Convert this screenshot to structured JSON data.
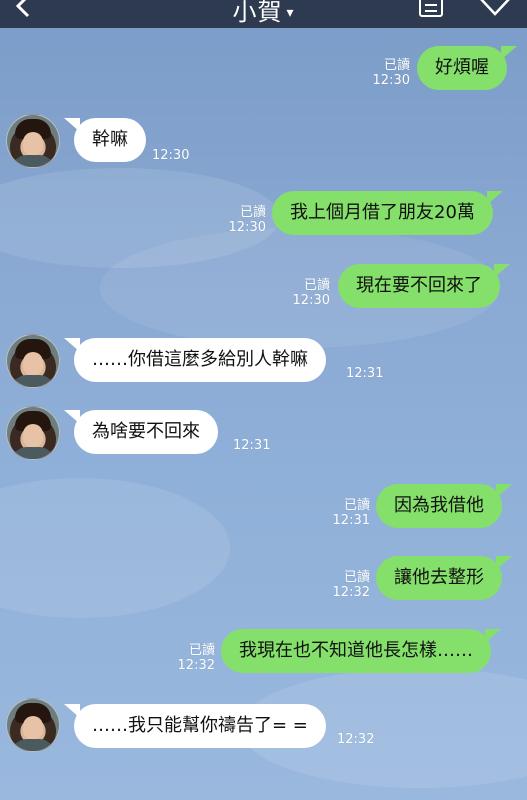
{
  "header": {
    "title": "小賀",
    "caret": "▾",
    "back_icon": "chevron-left-icon",
    "menu_icon": "notes-icon",
    "more_icon": "chevron-down-heart-icon"
  },
  "colors": {
    "outgoing_bubble": "#84e06a",
    "incoming_bubble": "#ffffff",
    "header": "#2d3a4f"
  },
  "messages": [
    {
      "dir": "out",
      "text": "好煩喔",
      "read": "已讀",
      "time": "12:30"
    },
    {
      "dir": "in",
      "text": "幹嘛",
      "time": "12:30"
    },
    {
      "dir": "out",
      "text": "我上個月借了朋友20萬",
      "read": "已讀",
      "time": "12:30"
    },
    {
      "dir": "out",
      "text": "現在要不回來了",
      "read": "已讀",
      "time": "12:30"
    },
    {
      "dir": "in",
      "text": "……你借這麼多給別人幹嘛",
      "time": "12:31"
    },
    {
      "dir": "in",
      "text": "為啥要不回來",
      "time": "12:31"
    },
    {
      "dir": "out",
      "text": "因為我借他",
      "read": "已讀",
      "time": "12:31"
    },
    {
      "dir": "out",
      "text": "讓他去整形",
      "read": "已讀",
      "time": "12:32"
    },
    {
      "dir": "out",
      "text": "我現在也不知道他長怎樣……",
      "read": "已讀",
      "time": "12:32"
    },
    {
      "dir": "in",
      "text": "……我只能幫你禱告了= =",
      "time": "12:32"
    }
  ]
}
